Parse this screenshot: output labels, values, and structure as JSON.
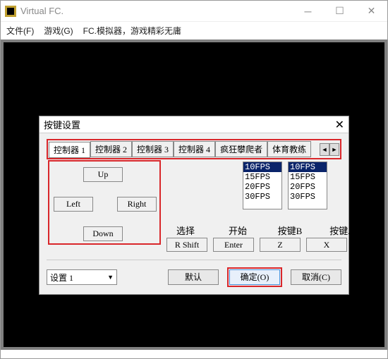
{
  "window": {
    "title": "Virtual FC."
  },
  "menu": {
    "file": "文件(F)",
    "game": "游戏(G)",
    "extra": "FC.模拟器，游戏精彩无庸"
  },
  "dialog": {
    "title": "按键设置",
    "tabs": [
      "控制器 1",
      "控制器 2",
      "控制器 3",
      "控制器 4",
      "疯狂攀爬者",
      "体育教练"
    ],
    "active_tab": 0,
    "dpad": {
      "up": "Up",
      "down": "Down",
      "left": "Left",
      "right": "Right"
    },
    "fps_options": [
      "10FPS",
      "15FPS",
      "20FPS",
      "30FPS"
    ],
    "fps1_selected": 0,
    "fps2_selected": 0,
    "labels": {
      "select": "选择",
      "start": "开始",
      "btnB": "按键B",
      "btnA": "按键A"
    },
    "values": {
      "select": "R Shift",
      "start": "Enter",
      "btnB": "Z",
      "btnA": "X"
    },
    "preset": "设置 1",
    "buttons": {
      "default": "默认",
      "ok": "确定(O)",
      "cancel": "取消(C)"
    }
  }
}
